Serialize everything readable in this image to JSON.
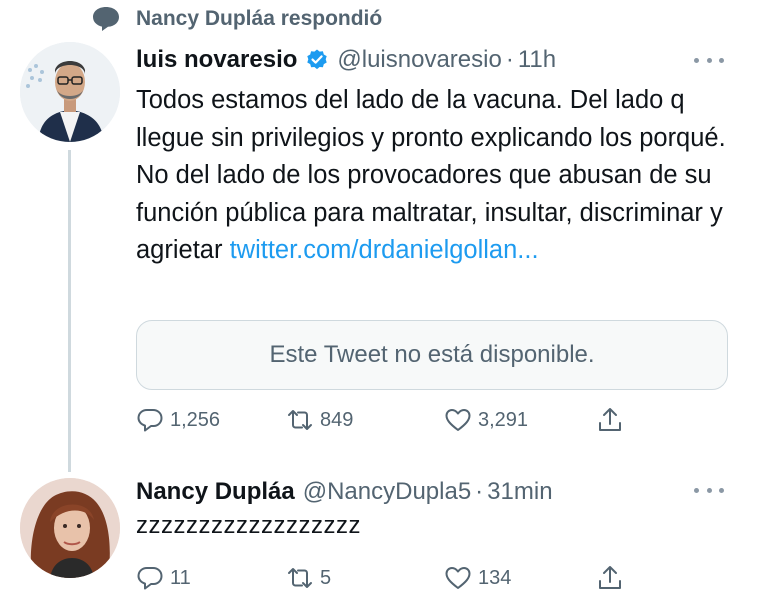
{
  "social_context": {
    "text": "Nancy Dupláa respondió",
    "icon": "speech-bubble-icon"
  },
  "tweets": [
    {
      "display_name": "luis novaresio",
      "verified": true,
      "handle": "@luisnovaresio",
      "time": "11h",
      "body": "Todos estamos del lado  de la vacuna.  Del lado q llegue sin privilegios y pronto explicando los porqué. No del lado de los provocadores que abusan de su función pública para maltratar, insultar, discriminar y agrietar",
      "link": "twitter.com/drdanielgollan...",
      "quote_unavailable": "Este Tweet no está disponible.",
      "replies": "1,256",
      "retweets": "849",
      "likes": "3,291"
    },
    {
      "display_name": "Nancy Dupláa",
      "verified": false,
      "handle": "@NancyDupla5",
      "time": "31min",
      "body": "zzzzzzzzzzzzzzzzzz",
      "replies": "11",
      "retweets": "5",
      "likes": "134"
    }
  ],
  "separator": "·",
  "colors": {
    "text": "#0f1419",
    "secondary": "#536471",
    "link": "#1d9bf0",
    "verified": "#1d9bf0",
    "thread_line": "#cfd9de"
  }
}
